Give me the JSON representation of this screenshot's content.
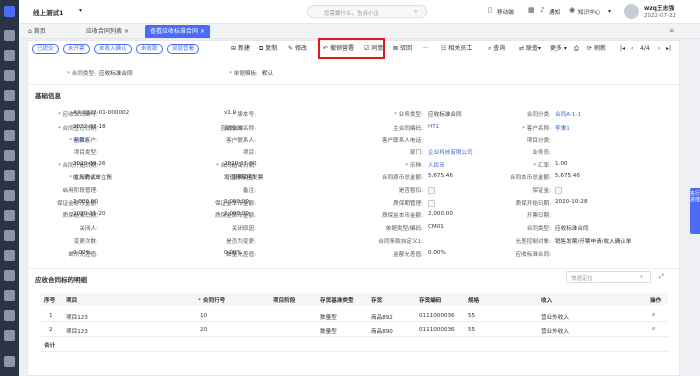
{
  "app": {
    "title": "线上测试1"
  },
  "topbar": {
    "search_placeholder": "您需要什么，告诉小企",
    "mobile": "移动端",
    "notify": "通知",
    "knowledge": "知识中心",
    "user_name": "wzq王志强",
    "date": "2022-07-22"
  },
  "tabs": [
    {
      "label": "首页"
    },
    {
      "label": "应收合同列表"
    },
    {
      "label": "查看应收标准合同"
    }
  ],
  "status_buttons": [
    "已提交",
    "未开票",
    "未收入确认",
    "未收款",
    "双层营署"
  ],
  "toolbar": {
    "new": "新建",
    "copy": "复制",
    "edit": "修改",
    "revoke": "撤销营署",
    "agree": "同意",
    "reject": "驳回",
    "more_dots": "···",
    "related": "相关员工",
    "query": "查询",
    "link": "联查",
    "more": "更多",
    "refresh": "刷新",
    "page": "4/4"
  },
  "header_fields": [
    {
      "label": "合同类型:",
      "value": "应收标准合同"
    },
    {
      "label": "单据模板:",
      "value": "默认"
    }
  ],
  "basic_section": {
    "title": "基础信息"
  },
  "fields": {
    "r1": [
      {
        "label": "应收合同编号:",
        "value": "AX-2022-01-000002",
        "req": true
      },
      {
        "label": "版本号:",
        "value": "v1.0",
        "req": true
      },
      {
        "label": "业务类型:",
        "value": "应收标准合同",
        "req": true
      },
      {
        "label": "合同分类:",
        "value": "合同A-1-1",
        "link": true
      }
    ],
    "r2": [
      {
        "label": "合同签订日期:",
        "value": "2022-02-18",
        "req": true
      },
      {
        "label": "应收合同名称:",
        "value": "合同09"
      },
      {
        "label": "主合同编码:",
        "value": "HT1",
        "link": true
      },
      {
        "label": "客户名称:",
        "value": "李秉1",
        "req": true,
        "link": true
      }
    ],
    "r3": [
      {
        "label": "结算客户:",
        "value": "李秉1",
        "req": true,
        "link": true
      },
      {
        "label": "客户联系人:",
        "value": ""
      },
      {
        "label": "客户联系人电话:",
        "value": ""
      },
      {
        "label": "项目分类:",
        "value": ""
      }
    ],
    "r4": [
      {
        "label": "项目类型:",
        "value": ""
      },
      {
        "label": "项目:",
        "value": ""
      },
      {
        "label": "部门:",
        "value": "企业科技有限公司",
        "link": true
      },
      {
        "label": "业务员:",
        "value": ""
      }
    ],
    "r5": [
      {
        "label": "合同开始日期:",
        "value": "2020-09-26",
        "req": true
      },
      {
        "label": "合同结束日期:",
        "value": "2020-11-30",
        "req": true
      },
      {
        "label": "币种:",
        "value": "人民币",
        "req": true,
        "link": true
      },
      {
        "label": "汇率:",
        "value": "1.00",
        "req": true
      }
    ],
    "r6": [
      {
        "label": "立账方式:",
        "value": "收入确认单立账",
        "req": true
      },
      {
        "label": "发票类型:",
        "value": "增值税专用发票"
      },
      {
        "label": "合同原币总金额:",
        "value": "5,675.46"
      },
      {
        "label": "合同本币总金额:",
        "value": "5,675.46"
      }
    ],
    "r7": [
      {
        "label": "启用阶段管理:",
        "value": ""
      },
      {
        "label": "备注:",
        "value": ""
      },
      {
        "label": "是否暂扣:",
        "value": ""
      },
      {
        "label": "保证金:",
        "value": ""
      }
    ],
    "r8": [
      {
        "label": "保证金原币金额:",
        "value": "2,000.00"
      },
      {
        "label": "保证金本币金额:",
        "value": "2,000.00"
      },
      {
        "label": "质保期管理:",
        "value": ""
      },
      {
        "label": "质保开始日期:",
        "value": "2020-10-28"
      }
    ],
    "r9": [
      {
        "label": "质保结束日期:",
        "value": "2020-11-20"
      },
      {
        "label": "质保金原币金额:",
        "value": "2,000.00"
      },
      {
        "label": "质保金本币金额:",
        "value": "2,000.00"
      },
      {
        "label": "开票日期:",
        "value": ""
      }
    ],
    "r10": [
      {
        "label": "关闭人:",
        "value": ""
      },
      {
        "label": "关闭原因:",
        "value": ""
      },
      {
        "label": "单据类型/编码:",
        "value": "CM01"
      },
      {
        "label": "合同类型:",
        "value": "应收标准合同"
      }
    ],
    "r11": [
      {
        "label": "变更次数:",
        "value": ""
      },
      {
        "label": "是否为变更:",
        "value": ""
      },
      {
        "label": "合同条款自定义1:",
        "value": ""
      },
      {
        "label": "允差控制对象:",
        "value": "销售发票/开票申请/收入确认单"
      }
    ],
    "r12": [
      {
        "label": "单价允差值:",
        "value": "0.00%"
      },
      {
        "label": "数量允差值:",
        "value": "0.00%"
      },
      {
        "label": "金额允差值:",
        "value": "0.00%"
      },
      {
        "label": "应收标准合同:",
        "value": ""
      }
    ]
  },
  "detail_section": {
    "title": "应收合同标的明细",
    "locate_placeholder": "快速定位"
  },
  "table": {
    "headers": [
      "序号",
      "项目",
      "合同行号",
      "项目阶段",
      "存货基准类型",
      "存货",
      "存货编码",
      "规格",
      "收入",
      "操作"
    ],
    "rows": [
      {
        "seq": "1",
        "project": "项目123",
        "line": "10",
        "stage": "",
        "type": "数量型",
        "inv": "商品892",
        "code": "0111000036",
        "spec": "55",
        "income": "营业外收入"
      },
      {
        "seq": "2",
        "project": "项目123",
        "line": "20",
        "stage": "",
        "type": "数量型",
        "inv": "商品890",
        "code": "0111000036",
        "spec": "55",
        "income": "营业外收入"
      }
    ],
    "footer": "合计"
  },
  "float_button": "执行进度",
  "colors": {
    "accent": "#4a6cf7",
    "sidebar": "#2b3445",
    "highlight": "#e0191b",
    "required": "#e53935"
  }
}
